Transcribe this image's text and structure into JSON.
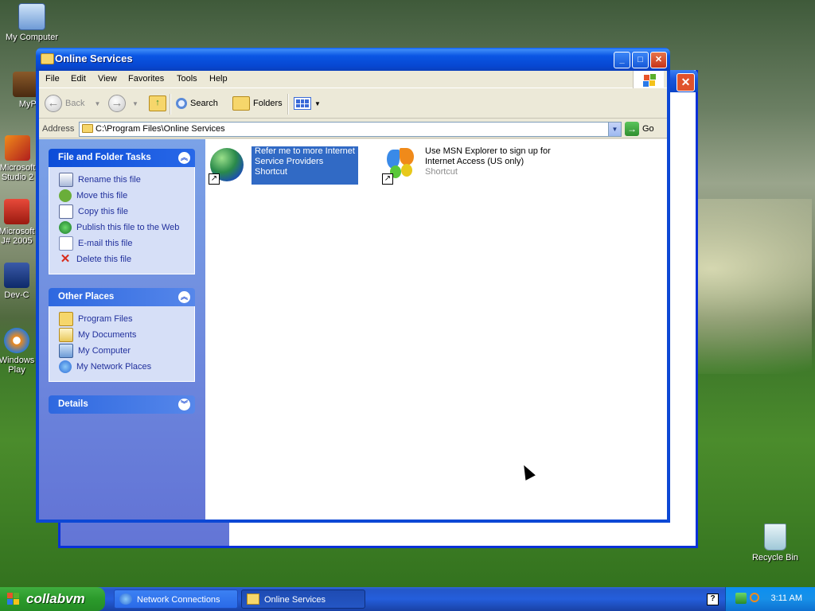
{
  "desktop": {
    "icons": [
      {
        "label": "My Computer"
      },
      {
        "label": "MyPa"
      },
      {
        "label": "Microsoft Studio 2"
      },
      {
        "label": "Microsoft J# 2005"
      },
      {
        "label": "Dev-C"
      },
      {
        "label": "Windows Play"
      },
      {
        "label": "Recycle Bin"
      }
    ]
  },
  "window": {
    "title": "Online Services",
    "menu": [
      "File",
      "Edit",
      "View",
      "Favorites",
      "Tools",
      "Help"
    ],
    "toolbar": {
      "back": "Back",
      "search": "Search",
      "folders": "Folders"
    },
    "address": {
      "label": "Address",
      "value": "C:\\Program Files\\Online Services",
      "go": "Go"
    }
  },
  "left_pane": {
    "file_tasks": {
      "title": "File and Folder Tasks",
      "items": [
        "Rename this file",
        "Move this file",
        "Copy this file",
        "Publish this file to the Web",
        "E-mail this file",
        "Delete this file"
      ]
    },
    "other_places": {
      "title": "Other Places",
      "items": [
        "Program Files",
        "My Documents",
        "My Computer",
        "My Network Places"
      ]
    },
    "details": {
      "title": "Details"
    }
  },
  "files": [
    {
      "line1": "Refer me to more Internet",
      "line2": "Service Providers",
      "type": "Shortcut",
      "selected": true
    },
    {
      "line1": "Use MSN Explorer to sign up for",
      "line2": "Internet Access (US only)",
      "type": "Shortcut",
      "selected": false
    }
  ],
  "taskbar": {
    "start": "collabvm",
    "tasks": [
      "Network Connections",
      "Online Services"
    ],
    "clock": "3:11 AM"
  },
  "colors": {
    "titlebar": "#0a56e4",
    "selection": "#316ac5",
    "task_link": "#21309c"
  }
}
